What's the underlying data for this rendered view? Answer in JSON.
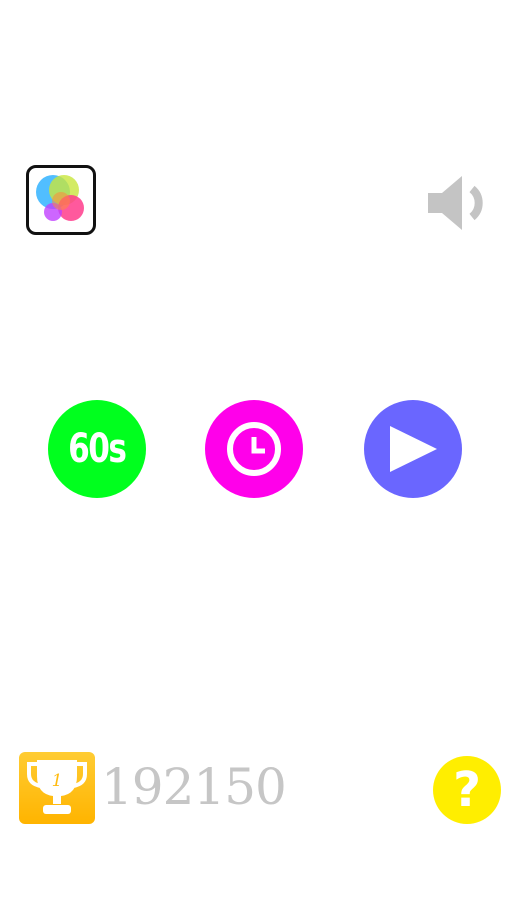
{
  "top_bar": {
    "game_center_icon": "game-center-bubbles-icon",
    "sound_icon": "speaker-on-icon"
  },
  "modes": [
    {
      "id": "sixty-seconds",
      "label": "60s",
      "color": "#00ff1e"
    },
    {
      "id": "timed",
      "icon": "clock-icon",
      "color": "#ff00ea"
    },
    {
      "id": "classic",
      "icon": "play-icon",
      "color": "#6a66ff"
    }
  ],
  "bottom_bar": {
    "trophy_icon": "trophy-icon",
    "trophy_rank": "1",
    "best_score": "192150",
    "help_label": "?",
    "help_color": "#ffee00"
  }
}
